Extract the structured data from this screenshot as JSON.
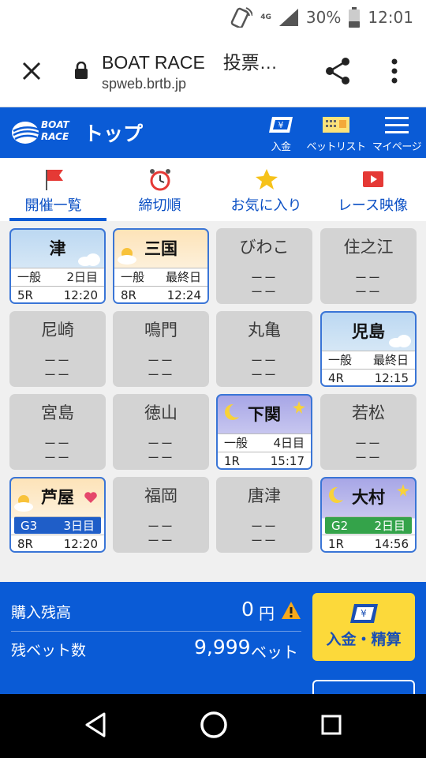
{
  "status_bar": {
    "network": "4G",
    "battery": "30%",
    "time": "12:01"
  },
  "browser": {
    "title": "BOAT RACE　投票…",
    "url": "spweb.brtb.jp"
  },
  "header": {
    "logo_line1": "BOAT",
    "logo_line2": "RACE",
    "page_title": "トップ",
    "deposit_label": "入金",
    "betlist_label": "ベットリスト",
    "mypage_label": "マイページ"
  },
  "tabs": [
    {
      "label": "開催一覧",
      "icon": "flag-icon",
      "active": true
    },
    {
      "label": "締切順",
      "icon": "alarm-clock-icon",
      "active": false
    },
    {
      "label": "お気に入り",
      "icon": "star-icon",
      "active": false
    },
    {
      "label": "レース映像",
      "icon": "video-play-icon",
      "active": false
    }
  ],
  "venues": [
    {
      "name": "津",
      "state": "open",
      "theme": "day",
      "grade": "一般",
      "day": "2日目",
      "race": "5R",
      "time": "12:20"
    },
    {
      "name": "三国",
      "state": "open",
      "theme": "sun",
      "grade": "一般",
      "day": "最終日",
      "race": "8R",
      "time": "12:24"
    },
    {
      "name": "びわこ",
      "state": "closed",
      "dash1": "ーー",
      "dash2": "ーー"
    },
    {
      "name": "住之江",
      "state": "closed",
      "dash1": "ーー",
      "dash2": "ーー"
    },
    {
      "name": "尼崎",
      "state": "closed",
      "dash1": "ーー",
      "dash2": "ーー"
    },
    {
      "name": "鳴門",
      "state": "closed",
      "dash1": "ーー",
      "dash2": "ーー"
    },
    {
      "name": "丸亀",
      "state": "closed",
      "dash1": "ーー",
      "dash2": "ーー"
    },
    {
      "name": "児島",
      "state": "open",
      "theme": "day",
      "grade": "一般",
      "day": "最終日",
      "race": "4R",
      "time": "12:15"
    },
    {
      "name": "宮島",
      "state": "closed",
      "dash1": "ーー",
      "dash2": "ーー"
    },
    {
      "name": "徳山",
      "state": "closed",
      "dash1": "ーー",
      "dash2": "ーー"
    },
    {
      "name": "下関",
      "state": "open",
      "theme": "night",
      "grade": "一般",
      "day": "4日目",
      "race": "1R",
      "time": "15:17"
    },
    {
      "name": "若松",
      "state": "closed",
      "dash1": "ーー",
      "dash2": "ーー"
    },
    {
      "name": "芦屋",
      "state": "open",
      "theme": "sun",
      "grade": "G3",
      "day": "3日目",
      "race": "8R",
      "time": "12:20",
      "favorite": true
    },
    {
      "name": "福岡",
      "state": "closed",
      "dash1": "ーー",
      "dash2": "ーー"
    },
    {
      "name": "唐津",
      "state": "closed",
      "dash1": "ーー",
      "dash2": "ーー"
    },
    {
      "name": "大村",
      "state": "open",
      "theme": "night",
      "grade": "G2",
      "day": "2日目",
      "race": "1R",
      "time": "14:56"
    }
  ],
  "balance": {
    "purchase_label": "購入残高",
    "purchase_value": "0",
    "purchase_unit": "円",
    "bets_label": "残ベット数",
    "bets_value": "9,999",
    "bets_unit": "ベット",
    "button_label": "入金・精算"
  },
  "colors": {
    "brand_blue": "#0a5bd6",
    "yellow": "#fcd93a",
    "g3_blue": "#1f5ec8",
    "g2_green": "#34a34a"
  }
}
